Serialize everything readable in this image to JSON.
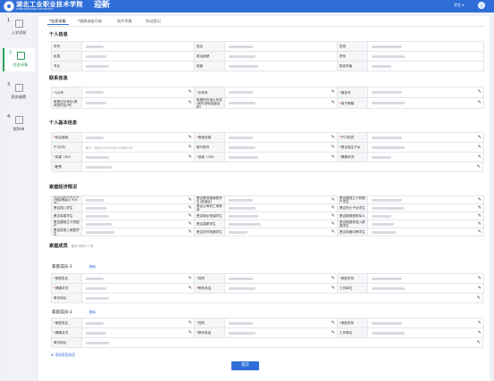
{
  "header": {
    "school_name": "湖北工业职业技术学院",
    "school_en": "HUBEI INDUSTRIAL POLYTECHNIC",
    "title": "迎新",
    "user": "学生 ▾"
  },
  "sidebar": {
    "items": [
      {
        "num": "1",
        "label": "入学须知"
      },
      {
        "num": "2",
        "label": "信息采集"
      },
      {
        "num": "3",
        "label": "财务缴费"
      },
      {
        "num": "4",
        "label": "报到单"
      }
    ]
  },
  "tabs": [
    "*信息采集",
    "*健康调查问卷",
    "照片采集",
    "到站登记"
  ],
  "sections": {
    "personal": "个人信息",
    "contact": "联系信息",
    "basic": "个人基本信息",
    "economic": "家庭经济情况",
    "family": "家庭成员",
    "family_hint": "最多可填写 2 条",
    "member1": "家庭成员-1",
    "member2": "家庭成员-2",
    "delete": "删除"
  },
  "personal": {
    "labels": [
      "学号",
      "姓名",
      "性别",
      "民族",
      "政治面貌",
      "院系",
      "专业",
      "班级",
      "报名年级"
    ]
  },
  "contact": {
    "labels": [
      "*QQ号",
      "*手机号",
      "*微信号",
      "家庭住址地址(具体到村及/号)",
      "家庭所在地火车站(填写该地县级名称)",
      "*电子邮箱"
    ]
  },
  "basic": {
    "labels": [
      "*政治面貌",
      "*宿舍设施",
      "*户口性质",
      "户口(村)",
      "银行账号",
      "*是否独生子女",
      "*体重（KG）",
      "*身高（CM）",
      "*健康状况",
      "*籍贯"
    ],
    "placeholder": "格式：湖北省XX市XX区XX街道XX号"
  },
  "economic": {
    "labels": [
      "是否残疾家庭学生(残疾等级以卡为准)",
      "是否是低保家庭学生(低保证)",
      "是否建档立卡贫困户学生",
      "是否孤儿学生",
      "是否父母双亡或单亲",
      "是否烈士子女学生",
      "是否军属学生",
      "是否城乡低保学生",
      "是否困难退役军人",
      "是否建档立卡贫困户",
      "是否高职学生",
      "是否城镇低收入家庭学生",
      "是否低收入家庭学生",
      "是否农村特困学生",
      "是否特困供养学生"
    ]
  },
  "family": {
    "labels": [
      "*家庭姓名",
      "*性别",
      "*家庭关系",
      "*健康状况",
      "*联系电话",
      "工作单位",
      "单位地址"
    ]
  },
  "actions": {
    "add_member": "添加家庭成员",
    "submit": "提交"
  }
}
